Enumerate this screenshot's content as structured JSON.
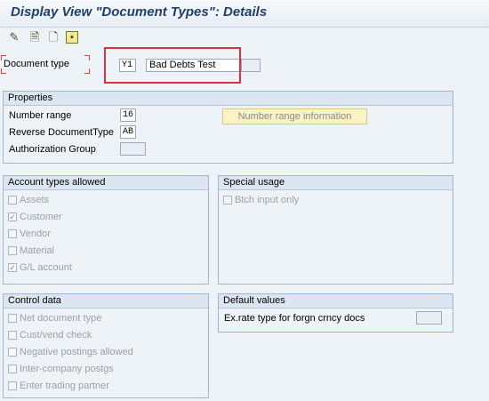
{
  "window": {
    "title": "Display View \"Document Types\": Details"
  },
  "toolbar": {
    "icons": [
      "edit-pencil-icon",
      "page-icon",
      "page-back-icon",
      "save-icon"
    ]
  },
  "header": {
    "document_type_label": "Document type",
    "document_type_code": "Y1",
    "document_type_text": "Bad Debts Test",
    "extra_field": ""
  },
  "properties": {
    "title": "Properties",
    "number_range_label": "Number range",
    "number_range_value": "16",
    "reverse_doc_type_label": "Reverse DocumentType",
    "reverse_doc_type_value": "AB",
    "authorization_group_label": "Authorization Group",
    "authorization_group_value": "",
    "number_range_info_button": "Number range information"
  },
  "account_types": {
    "title": "Account types allowed",
    "items": [
      {
        "label": "Assets",
        "checked": false
      },
      {
        "label": "Customer",
        "checked": true
      },
      {
        "label": "Vendor",
        "checked": false
      },
      {
        "label": "Material",
        "checked": false
      },
      {
        "label": "G/L account",
        "checked": true
      }
    ]
  },
  "special_usage": {
    "title": "Special usage",
    "items": [
      {
        "label": "Btch input only",
        "checked": false
      }
    ]
  },
  "control_data": {
    "title": "Control data",
    "items": [
      {
        "label": "Net document type",
        "checked": false
      },
      {
        "label": "Cust/vend check",
        "checked": false
      },
      {
        "label": "Negative postings allowed",
        "checked": false
      },
      {
        "label": "Inter-company postgs",
        "checked": false
      },
      {
        "label": "Enter trading partner",
        "checked": false
      }
    ]
  },
  "default_values": {
    "title": "Default values",
    "exrate_label": "Ex.rate type for forgn crncy docs",
    "exrate_value": ""
  },
  "colors": {
    "title_text": "#1f3f68",
    "highlight_box": "#d8343f",
    "group_header_bg": "#dbe6f1",
    "button_bg": "#fcf3c4"
  }
}
